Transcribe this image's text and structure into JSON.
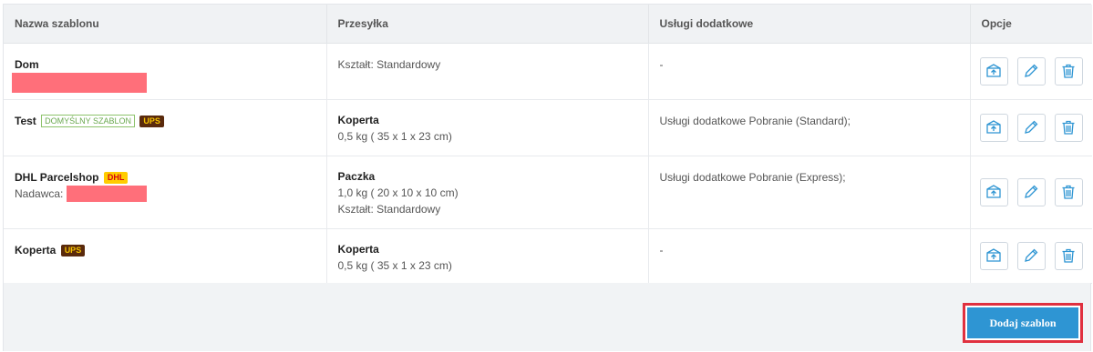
{
  "table": {
    "headers": [
      "Nazwa szablonu",
      "Przesyłka",
      "Usługi dodatkowe",
      "Opcje"
    ],
    "rows": [
      {
        "name": "Dom",
        "shipment_lines": [
          "Kształt: Standardowy"
        ],
        "services": "-"
      },
      {
        "name": "Test",
        "badge_default": "DOMYŚLNY SZABLON",
        "carrier_badge": "UPS",
        "shipment_title": "Koperta",
        "shipment_lines": [
          "0,5 kg ( 35 x 1 x 23 cm)"
        ],
        "services": "Usługi dodatkowe Pobranie (Standard);"
      },
      {
        "name": "DHL Parcelshop",
        "carrier_badge": "DHL",
        "sender_label": "Nadawca:",
        "shipment_title": "Paczka",
        "shipment_lines": [
          "1,0 kg ( 20 x 10 x 10 cm)",
          "Kształt: Standardowy"
        ],
        "services": "Usługi dodatkowe Pobranie (Express);"
      },
      {
        "name": "Koperta",
        "carrier_badge": "UPS",
        "shipment_title": "Koperta",
        "shipment_lines": [
          "0,5 kg ( 35 x 1 x 23 cm)"
        ],
        "services": "-"
      }
    ]
  },
  "options_icons": [
    "upload-box-icon",
    "pencil-icon",
    "trash-icon"
  ],
  "add_button": "Dodaj szablon",
  "colors": {
    "accent": "#2e95d3",
    "highlight_border": "#e0303f",
    "redacted": "#ff6f7a"
  }
}
